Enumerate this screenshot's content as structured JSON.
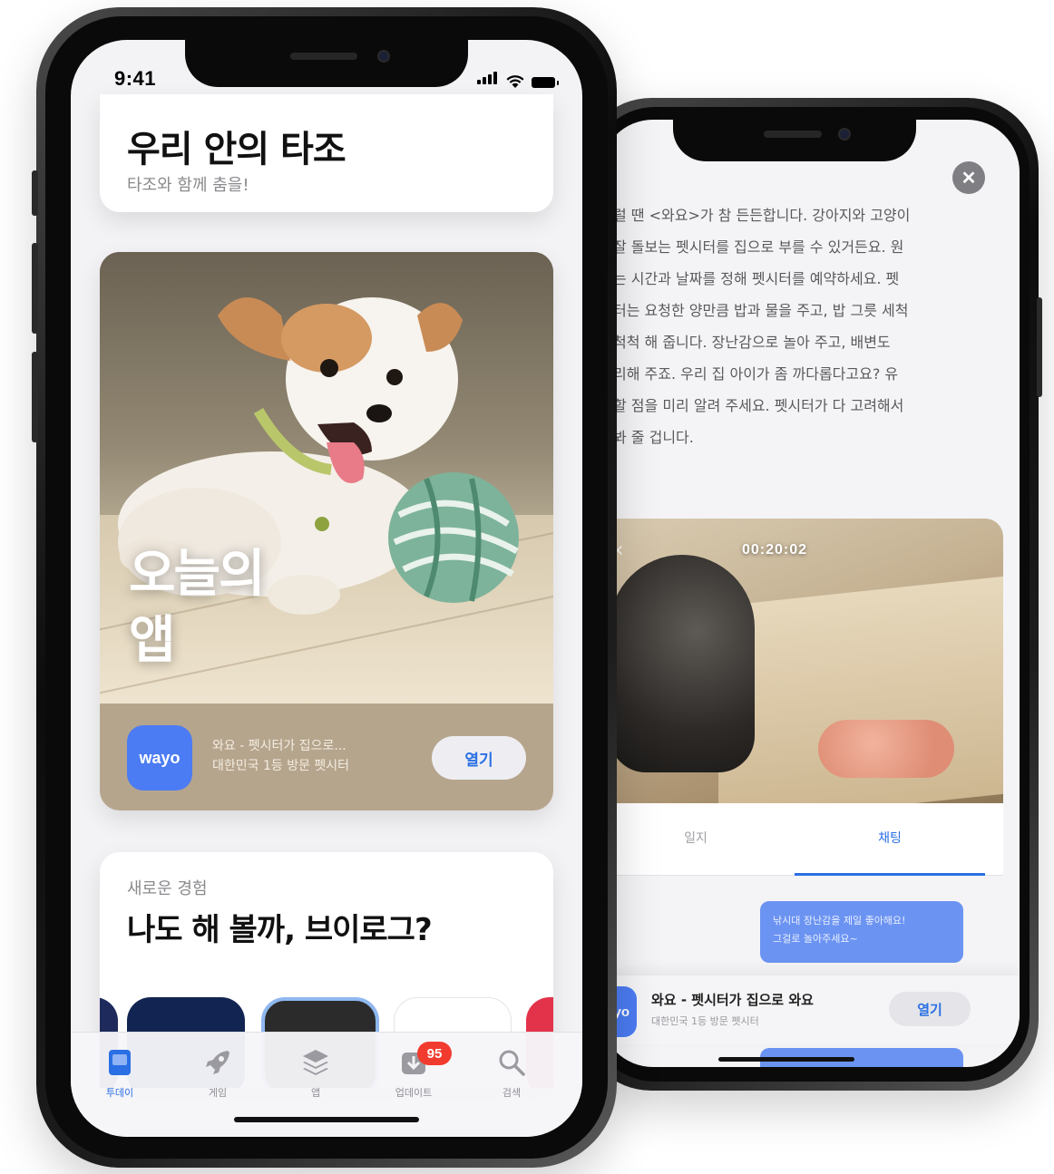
{
  "front": {
    "status": {
      "time": "9:41"
    },
    "card_tajo": {
      "title": "우리 안의 타조",
      "subtitle": "타조와 함께 춤을!"
    },
    "card_today": {
      "label_line1": "오늘의",
      "label_line2": "앱",
      "app": {
        "icon_text": "wayo",
        "name": "와요 - 펫시터가 집으로...",
        "description": "대한민국 1등 방문 펫시터",
        "open_label": "열기"
      }
    },
    "card_vlog": {
      "eyebrow": "새로운 경험",
      "title": "나도 해 볼까, 브이로그?"
    },
    "tabs": [
      {
        "label": "투데이",
        "icon": "today-icon"
      },
      {
        "label": "게임",
        "icon": "rocket-icon"
      },
      {
        "label": "앱",
        "icon": "layers-icon"
      },
      {
        "label": "업데이트",
        "icon": "download-icon",
        "badge": "95"
      },
      {
        "label": "검색",
        "icon": "search-icon"
      }
    ],
    "colors": {
      "accent": "#2a6fe4",
      "brand": "#4c7cf3",
      "badge": "#f23b2f"
    }
  },
  "back": {
    "article_lines": [
      "럴 땐 <와요>가 참 든든합니다. 강아지와 고양이",
      "잘 돌보는 펫시터를 집으로 부를 수 있거든요. 원",
      "는 시간과 날짜를 정해 펫시터를 예약하세요. 펫",
      "터는 요청한 양만큼 밥과 물을 주고, 밥 그릇 세척",
      "척척 해 줍니다. 장난감으로 놀아 주고, 배변도",
      "리해 주죠. 우리 집 아이가 좀 까다롭다고요? 유",
      "할 점을 미리 알려 주세요. 펫시터가 다 고려해서",
      "봐 줄 겁니다."
    ],
    "camera": {
      "timer": "00:20:02"
    },
    "segment": {
      "left": "일지",
      "right": "채팅"
    },
    "chat": {
      "line1": "낚시대 장난감을 제일 좋아해요!",
      "line2": "그걸로 놀아주세요~"
    },
    "app": {
      "icon_text": "wayo",
      "name": "와요 - 펫시터가 집으로 와요",
      "description": "대한민국 1등 방문 펫시터",
      "open_label": "열기"
    }
  }
}
